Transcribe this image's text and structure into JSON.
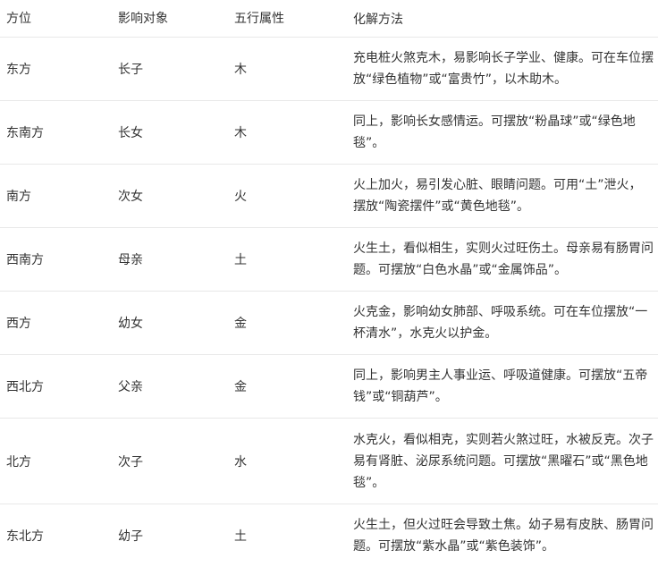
{
  "headers": [
    "方位",
    "影响对象",
    "五行属性",
    "化解方法"
  ],
  "rows": [
    {
      "direction": "东方",
      "target": "长子",
      "element": "木",
      "remedy": "充电桩火煞克木，易影响长子学业、健康。可在车位摆放“绿色植物”或“富贵竹”，以木助木。"
    },
    {
      "direction": "东南方",
      "target": "长女",
      "element": "木",
      "remedy": "同上，影响长女感情运。可摆放“粉晶球”或“绿色地毯”。"
    },
    {
      "direction": "南方",
      "target": "次女",
      "element": "火",
      "remedy": "火上加火，易引发心脏、眼睛问题。可用“土”泄火，摆放“陶瓷摆件”或“黄色地毯”。"
    },
    {
      "direction": "西南方",
      "target": "母亲",
      "element": "土",
      "remedy": "火生土，看似相生，实则火过旺伤土。母亲易有肠胃问题。可摆放“白色水晶”或“金属饰品”。"
    },
    {
      "direction": "西方",
      "target": "幼女",
      "element": "金",
      "remedy": "火克金，影响幼女肺部、呼吸系统。可在车位摆放“一杯清水”，水克火以护金。"
    },
    {
      "direction": "西北方",
      "target": "父亲",
      "element": "金",
      "remedy": "同上，影响男主人事业运、呼吸道健康。可摆放“五帝钱”或“铜葫芦”。"
    },
    {
      "direction": "北方",
      "target": "次子",
      "element": "水",
      "remedy": "水克火，看似相克，实则若火煞过旺，水被反克。次子易有肾脏、泌尿系统问题。可摆放“黑曜石”或“黑色地毯”。"
    },
    {
      "direction": "东北方",
      "target": "幼子",
      "element": "土",
      "remedy": "火生土，但火过旺会导致土焦。幼子易有皮肤、肠胃问题。可摆放“紫水晶”或“紫色装饰”。"
    }
  ]
}
